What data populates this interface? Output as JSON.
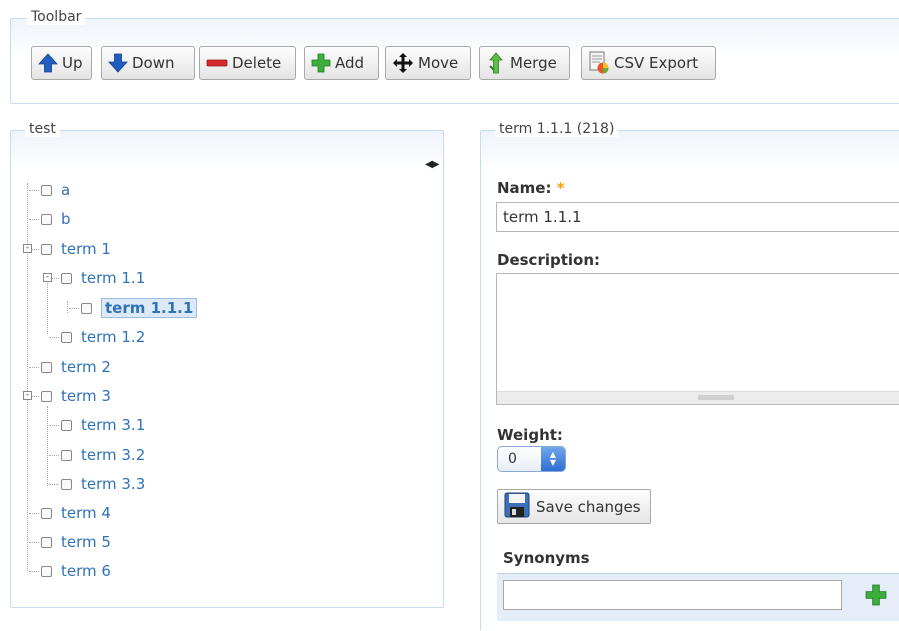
{
  "toolbar": {
    "legend": "Toolbar",
    "buttons": {
      "up": "Up",
      "down": "Down",
      "delete": "Delete",
      "add": "Add",
      "move": "Move",
      "merge": "Merge",
      "csv_export": "CSV Export"
    }
  },
  "tree": {
    "legend": "test",
    "nodes": {
      "a": "a",
      "b": "b",
      "term1": "term 1",
      "term1_1": "term 1.1",
      "term1_1_1": "term 1.1.1",
      "term1_2": "term 1.2",
      "term2": "term 2",
      "term3": "term 3",
      "term3_1": "term 3.1",
      "term3_2": "term 3.2",
      "term3_3": "term 3.3",
      "term4": "term 4",
      "term5": "term 5",
      "term6": "term 6"
    },
    "selected": "term 1.1.1"
  },
  "editor": {
    "legend": "term 1.1.1 (218)",
    "name_label": "Name:",
    "required_mark": "*",
    "name_value": "term 1.1.1",
    "description_label": "Description:",
    "description_value": "",
    "weight_label": "Weight:",
    "weight_value": "0",
    "save_label": "Save changes",
    "synonyms_label": "Synonyms",
    "synonym_value": ""
  },
  "colors": {
    "link": "#2f72b8",
    "panel_border": "#c9dcef",
    "required": "#f0a500",
    "add_icon": "#3cae3c",
    "delete_icon": "#d42a2a",
    "arrow_icon": "#1f5fc4"
  },
  "icons": [
    "arrow-up-icon",
    "arrow-down-icon",
    "minus-icon",
    "plus-icon",
    "move-icon",
    "merge-icon",
    "csv-export-icon",
    "resize-arrows-icon",
    "floppy-disk-icon"
  ]
}
